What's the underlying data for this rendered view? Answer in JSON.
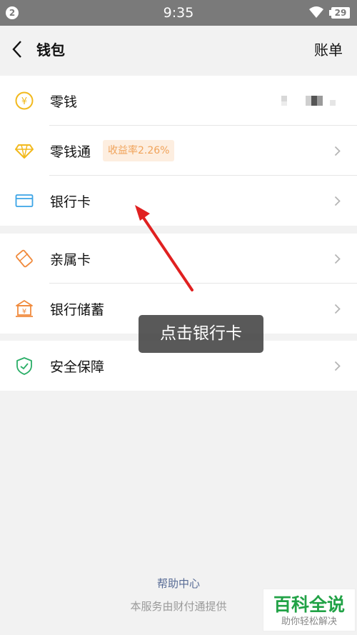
{
  "statusbar": {
    "notification_count": "2",
    "time": "9:35",
    "battery": "29"
  },
  "navbar": {
    "title": "钱包",
    "right_label": "账单"
  },
  "groups": [
    {
      "items": [
        {
          "label": "零钱",
          "icon": "yen-coin-icon"
        },
        {
          "label": "零钱通",
          "icon": "diamond-icon",
          "badge": "收益率2.26%"
        },
        {
          "label": "银行卡",
          "icon": "card-icon"
        }
      ]
    },
    {
      "items": [
        {
          "label": "亲属卡",
          "icon": "family-card-icon"
        },
        {
          "label": "银行储蓄",
          "icon": "bank-icon"
        }
      ]
    },
    {
      "items": [
        {
          "label": "安全保障",
          "icon": "shield-icon"
        }
      ]
    }
  ],
  "footer": {
    "help": "帮助中心",
    "provider": "本服务由财付通提供"
  },
  "overlay": {
    "toast": "点击银行卡"
  },
  "watermark": {
    "main": "百科全说",
    "sub": "助你轻松解决"
  },
  "colors": {
    "accent_green": "#2aae67",
    "coin_yellow": "#f2b91d",
    "orange": "#f08a3c",
    "blue": "#3ba4e6",
    "arrow_red": "#e02020"
  }
}
